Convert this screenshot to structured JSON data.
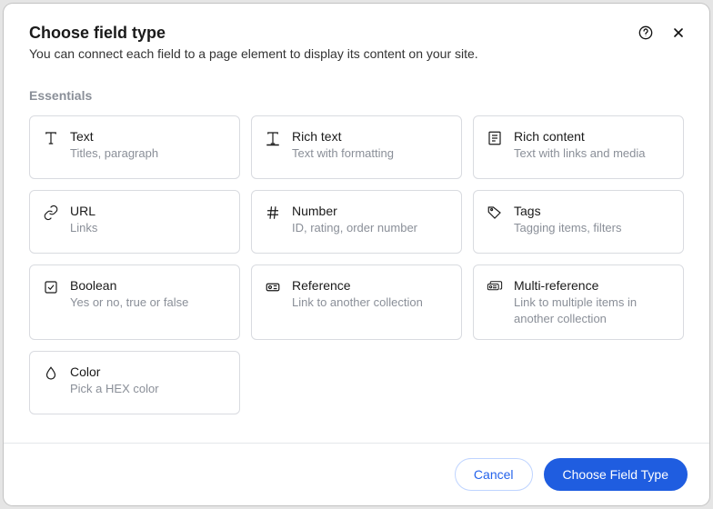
{
  "header": {
    "title": "Choose field type",
    "subtitle": "You can connect each field to a page element to display its content on your site."
  },
  "sections": {
    "essentials": "Essentials"
  },
  "fields": [
    {
      "icon": "text-icon",
      "title": "Text",
      "desc": "Titles, paragraph"
    },
    {
      "icon": "rich-text-icon",
      "title": "Rich text",
      "desc": "Text with formatting"
    },
    {
      "icon": "rich-content-icon",
      "title": "Rich content",
      "desc": "Text with links and media"
    },
    {
      "icon": "url-icon",
      "title": "URL",
      "desc": "Links"
    },
    {
      "icon": "number-icon",
      "title": "Number",
      "desc": "ID, rating, order number"
    },
    {
      "icon": "tags-icon",
      "title": "Tags",
      "desc": "Tagging items, filters"
    },
    {
      "icon": "boolean-icon",
      "title": "Boolean",
      "desc": "Yes or no, true or false"
    },
    {
      "icon": "reference-icon",
      "title": "Reference",
      "desc": "Link to another collection"
    },
    {
      "icon": "multi-reference-icon",
      "title": "Multi-reference",
      "desc": "Link to multiple items in another collection"
    },
    {
      "icon": "color-icon",
      "title": "Color",
      "desc": "Pick a HEX color"
    }
  ],
  "footer": {
    "cancel": "Cancel",
    "confirm": "Choose Field Type"
  }
}
